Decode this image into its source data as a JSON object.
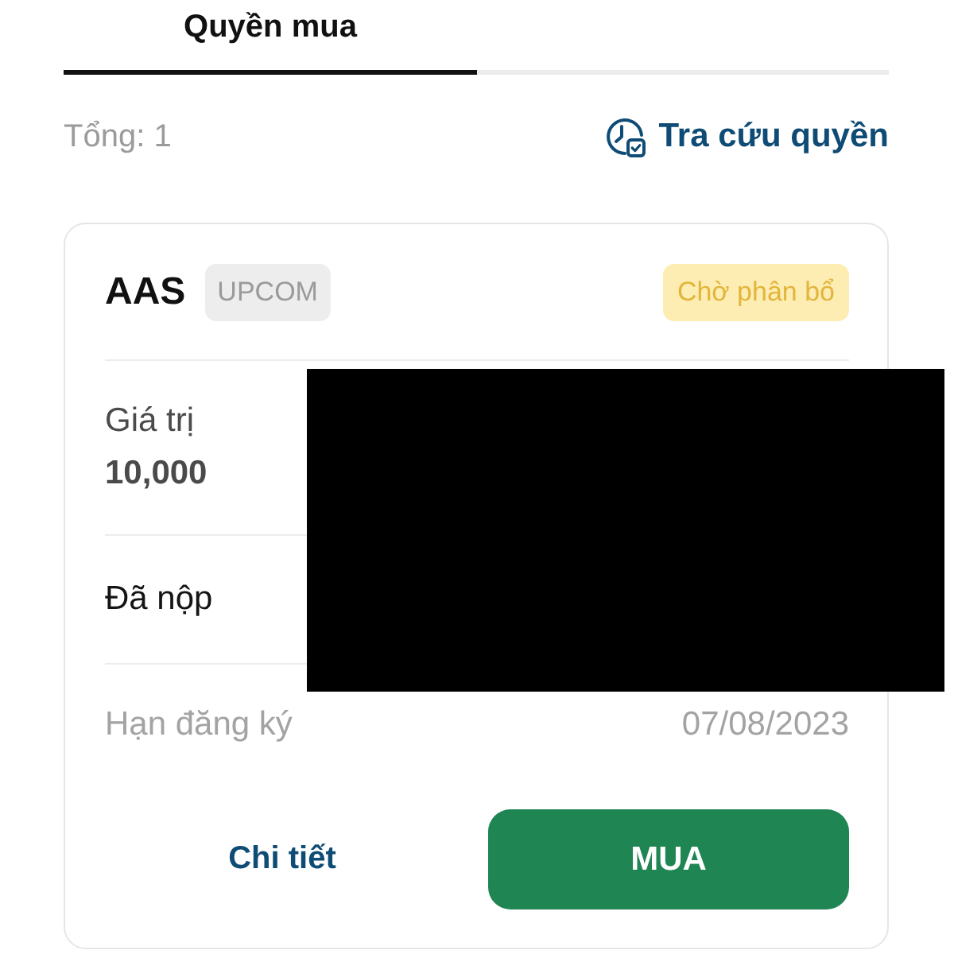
{
  "tabs": [
    {
      "label": "Quyền mua",
      "selected": true
    }
  ],
  "summary": {
    "total": "Tổng: 1",
    "lookup_link": "Tra cứu quyền"
  },
  "card": {
    "symbol": "AAS",
    "exchange": "UPCOM",
    "status": "Chờ phân bổ",
    "rows": [
      {
        "kind": "stacked",
        "label": "Giá trị",
        "value": "10,000",
        "muted": false
      },
      {
        "kind": "plain",
        "label": "Đã nộp",
        "muted": false
      },
      {
        "kind": "inline",
        "label": "Hạn đăng ký",
        "value": "07/08/2023",
        "muted": true
      }
    ],
    "buttons": [
      {
        "kind": "text",
        "label": "Chi tiết"
      },
      {
        "kind": "primary",
        "label": "MUA"
      }
    ]
  }
}
